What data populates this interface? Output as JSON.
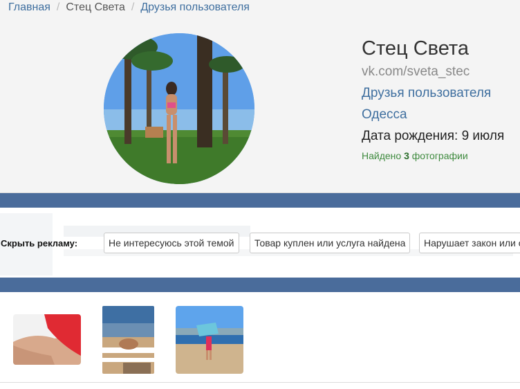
{
  "breadcrumb": {
    "home": "Главная",
    "profile": "Стец Света",
    "current": "Друзья пользователя"
  },
  "profile": {
    "name": "Стец Света",
    "url": "vk.com/sveta_stec",
    "friends_link": "Друзья пользователя",
    "city": "Одесса",
    "birthday": "Дата рождения: 9 июля",
    "found_prefix": "Найдено",
    "found_count": "3",
    "found_suffix": "фотографии"
  },
  "ad": {
    "hide_label": "Скрыть рекламу:",
    "reasons": [
      "Не интересуюсь этой темой",
      "Товар куплен или услуга найдена",
      "Нарушает закон или о"
    ]
  },
  "colors": {
    "link": "#3f6f9f",
    "bar": "#4a6c9b",
    "found": "#3e8a3e"
  }
}
